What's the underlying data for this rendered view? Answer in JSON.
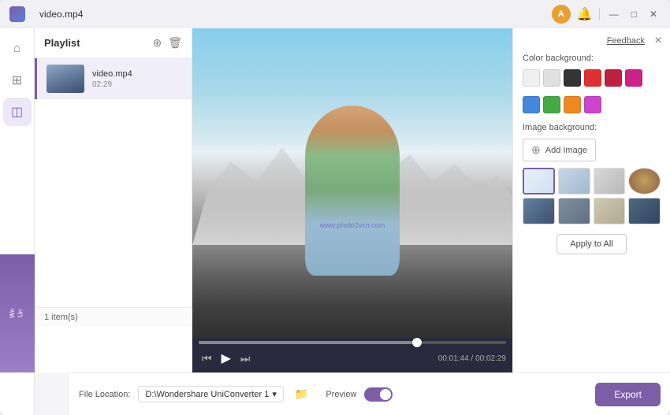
{
  "window": {
    "title": "video.mp4",
    "feedback_label": "Feedback"
  },
  "header": {
    "user_initial": "A",
    "minimize_btn": "—",
    "maximize_btn": "□",
    "close_btn": "✕"
  },
  "sidebar": {
    "items": [
      {
        "icon": "⌂",
        "label": "home",
        "active": false
      },
      {
        "icon": "⊞",
        "label": "convert",
        "active": false
      },
      {
        "icon": "◫",
        "label": "edit",
        "active": true
      }
    ]
  },
  "playlist": {
    "title": "Playlist",
    "items": [
      {
        "name": "video.mp4",
        "duration": "02:29"
      }
    ],
    "count": "1 item(s)"
  },
  "video": {
    "current_time": "00:01:44",
    "total_time": "00:02:29",
    "progress_percent": 71,
    "watermark": "www.photo2vcn.com"
  },
  "right_panel": {
    "color_bg_label": "Color background:",
    "image_bg_label": "Image background:",
    "add_image_label": "Add Image",
    "apply_to_all_label": "Apply to All",
    "close_icon": "✕",
    "colors_row1": [
      {
        "hex": "#f0f0f0",
        "id": "white"
      },
      {
        "hex": "#e0e0e0",
        "id": "light-gray"
      },
      {
        "hex": "#333333",
        "id": "black"
      },
      {
        "hex": "#e03030",
        "id": "red"
      },
      {
        "hex": "#c02040",
        "id": "crimson"
      },
      {
        "hex": "#cc2288",
        "id": "pink"
      }
    ],
    "colors_row2": [
      {
        "hex": "#4488dd",
        "id": "blue"
      },
      {
        "hex": "#44aa44",
        "id": "green"
      },
      {
        "hex": "#ee8822",
        "id": "orange"
      },
      {
        "hex": "#cc44cc",
        "id": "purple"
      }
    ]
  },
  "bottom_bar": {
    "file_location_label": "File Location:",
    "file_location_value": "D:\\Wondershare UniConverter 1",
    "preview_label": "Preview",
    "toggle_on": true,
    "export_label": "Export"
  },
  "purple_card": {
    "line1": "Wo",
    "line2": "Un"
  }
}
